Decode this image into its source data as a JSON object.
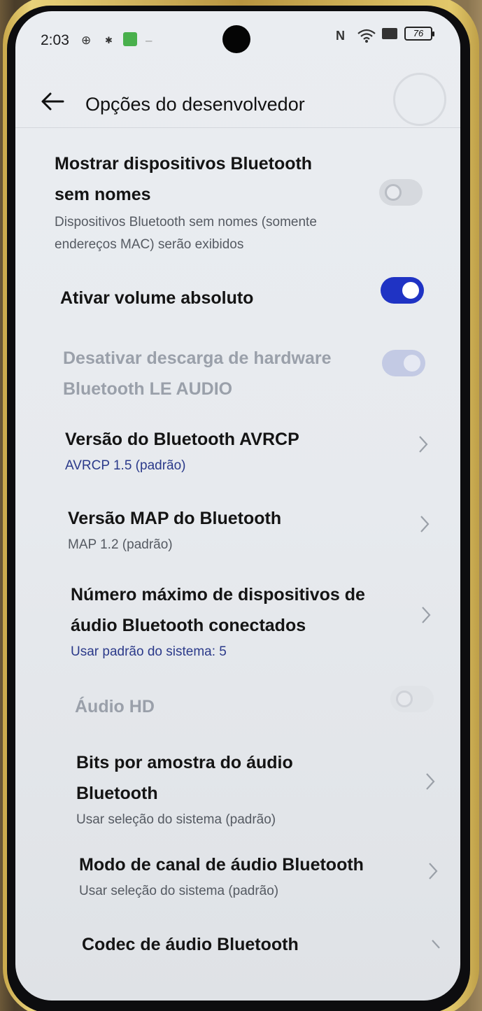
{
  "status_bar": {
    "time": "2:03",
    "battery": "76"
  },
  "header": {
    "title": "Opções do desenvolvedor"
  },
  "settings": [
    {
      "title_line1": "Mostrar dispositivos Bluetooth",
      "title_line2": "sem nomes",
      "subtitle_line1": "Dispositivos Bluetooth sem nomes (somente",
      "subtitle_line2": "endereços MAC) serão exibidos",
      "toggle": "off"
    },
    {
      "title": "Ativar volume absoluto",
      "toggle": "on"
    },
    {
      "title_line1": "Desativar descarga de hardware",
      "title_line2": "Bluetooth LE AUDIO",
      "toggle": "on-disabled"
    },
    {
      "title": "Versão do Bluetooth AVRCP",
      "subtitle": "AVRCP 1.5 (padrão)"
    },
    {
      "title": "Versão MAP do Bluetooth",
      "subtitle": "MAP 1.2 (padrão)"
    },
    {
      "title_line1": "Número máximo de dispositivos de",
      "title_line2": "áudio Bluetooth conectados",
      "subtitle": "Usar padrão do sistema: 5"
    },
    {
      "title": "Áudio HD",
      "toggle": "off-disabled"
    },
    {
      "title_line1": "Bits por amostra do áudio",
      "title_line2": "Bluetooth",
      "subtitle": "Usar seleção do sistema (padrão)"
    },
    {
      "title": "Modo de canal de áudio Bluetooth",
      "subtitle": "Usar seleção do sistema (padrão)"
    },
    {
      "title": "Codec de áudio Bluetooth"
    }
  ],
  "colors": {
    "accent": "#1f33c4",
    "accent_text": "#2b3a8a",
    "frame_gold": "#d9bb5c"
  }
}
